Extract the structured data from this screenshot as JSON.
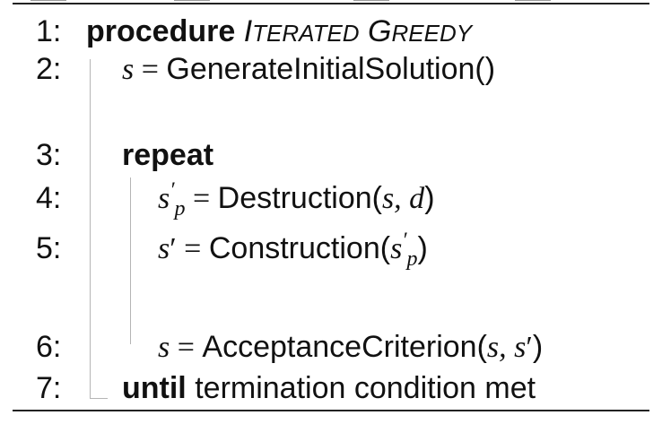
{
  "algorithm": {
    "lines": [
      {
        "num": "1:",
        "keyword": "procedure",
        "name_I": "I",
        "name_rest1": "TERATED",
        "name_G": "G",
        "name_rest2": "REEDY"
      },
      {
        "num": "2:",
        "var": "s",
        "op": " = ",
        "text": "GenerateInitialSolution()"
      },
      {
        "num": "3:",
        "keyword": "repeat"
      },
      {
        "num": "4:",
        "var": "s",
        "prime": "′",
        "sub": "p",
        "op": " = ",
        "func": "Destruction(",
        "args": "s, d",
        "close": ")"
      },
      {
        "num": "5:",
        "var": "s",
        "prime": "′",
        "op": " = ",
        "func": "Construction(",
        "arg_var": "s",
        "arg_prime": "′",
        "arg_sub": "p",
        "close": ")"
      },
      {
        "num": "6:",
        "var": "s",
        "op": " = ",
        "func": "AcceptanceCriterion(",
        "args": "s, s",
        "arg_prime": "′",
        "close": ")"
      },
      {
        "num": "7:",
        "keyword": "until",
        "text": " termination condition met"
      }
    ]
  }
}
